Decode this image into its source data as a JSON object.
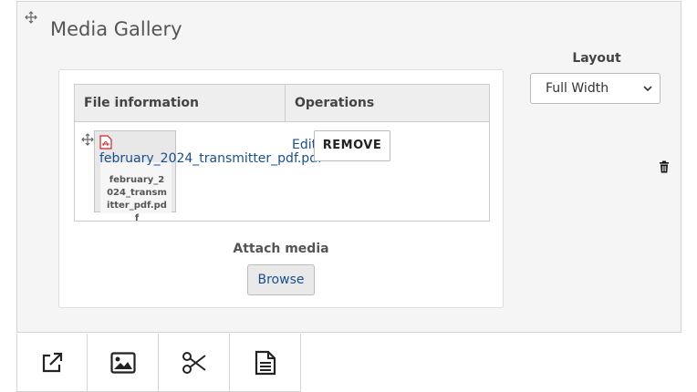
{
  "gallery": {
    "title": "Media Gallery",
    "table": {
      "headers": [
        "File information",
        "Operations"
      ],
      "rows": [
        {
          "thumbnail_caption": "february_2024_transmitter_pdf.pdf",
          "file_name": "february_2024_transmitter_pdf.pdf",
          "edit_label": "Edit",
          "remove_label": "REMOVE"
        }
      ]
    },
    "attach_label": "Attach media",
    "browse_label": "Browse"
  },
  "layout": {
    "label": "Layout",
    "selected": "Full Width"
  },
  "toolbar": {
    "buttons": [
      "external-link-icon",
      "image-icon",
      "scissors-icon",
      "document-icon"
    ]
  },
  "colors": {
    "link": "#1a4f8b",
    "panel_bg": "#f5f5f5",
    "pdf_red": "#d0202a"
  }
}
